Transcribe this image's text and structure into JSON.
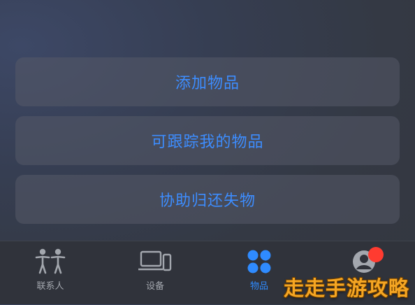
{
  "actions": {
    "add_item": "添加物品",
    "trackable_items": "可跟踪我的物品",
    "help_return": "协助归还失物"
  },
  "tabs": [
    {
      "label": "联系人",
      "icon": "people-icon",
      "active": false
    },
    {
      "label": "设备",
      "icon": "devices-icon",
      "active": false
    },
    {
      "label": "物品",
      "icon": "items-grid-icon",
      "active": true
    },
    {
      "label": "",
      "icon": "profile-icon",
      "active": false,
      "badge": true
    }
  ],
  "colors": {
    "accent": "#2f8bff",
    "badge": "#ff3b30",
    "inactive_tab": "#a3a7ae"
  },
  "watermark": "走走手游攻略"
}
